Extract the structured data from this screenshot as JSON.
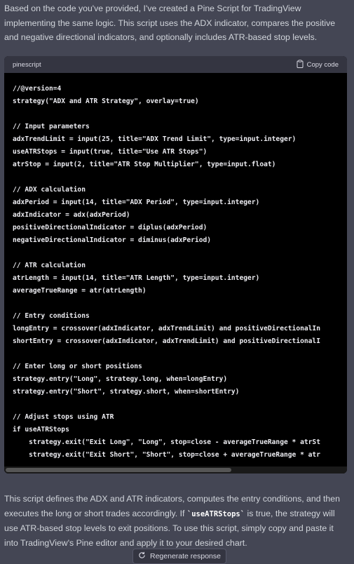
{
  "intro_text": "Based on the code you've provided, I've created a Pine Script for TradingView implementing the same logic. This script uses the ADX indicator, compares the positive and negative directional indicators, and optionally includes ATR-based stop levels.",
  "code_block": {
    "language": "pinescript",
    "copy_label": "Copy code",
    "copy_icon": "clipboard-icon",
    "lines": [
      "//@version=4",
      "strategy(\"ADX and ATR Strategy\", overlay=true)",
      "",
      "// Input parameters",
      "adxTrendLimit = input(25, title=\"ADX Trend Limit\", type=input.integer)",
      "useATRStops = input(true, title=\"Use ATR Stops\")",
      "atrStop = input(2, title=\"ATR Stop Multiplier\", type=input.float)",
      "",
      "// ADX calculation",
      "adxPeriod = input(14, title=\"ADX Period\", type=input.integer)",
      "adxIndicator = adx(adxPeriod)",
      "positiveDirectionalIndicator = diplus(adxPeriod)",
      "negativeDirectionalIndicator = diminus(adxPeriod)",
      "",
      "// ATR calculation",
      "atrLength = input(14, title=\"ATR Length\", type=input.integer)",
      "averageTrueRange = atr(atrLength)",
      "",
      "// Entry conditions",
      "longEntry = crossover(adxIndicator, adxTrendLimit) and positiveDirectionalIn",
      "shortEntry = crossover(adxIndicator, adxTrendLimit) and positiveDirectionalI",
      "",
      "// Enter long or short positions",
      "strategy.entry(\"Long\", strategy.long, when=longEntry)",
      "strategy.entry(\"Short\", strategy.short, when=shortEntry)",
      "",
      "// Adjust stops using ATR",
      "if useATRStops",
      "    strategy.exit(\"Exit Long\", \"Long\", stop=close - averageTrueRange * atrSt",
      "    strategy.exit(\"Exit Short\", \"Short\", stop=close + averageTrueRange * atr"
    ]
  },
  "outro": {
    "part1": "This script defines the ADX and ATR indicators, computes the entry conditions, and then executes the long or short trades accordingly. If ",
    "code": "`useATRStops`",
    "part2": " is true, the strategy will use ATR-based stop levels to exit positions. To use this script, simply copy and paste it into TradingView's Pine editor and apply it to your desired chart."
  },
  "regenerate": {
    "label": "Regenerate response",
    "icon": "refresh-icon"
  }
}
